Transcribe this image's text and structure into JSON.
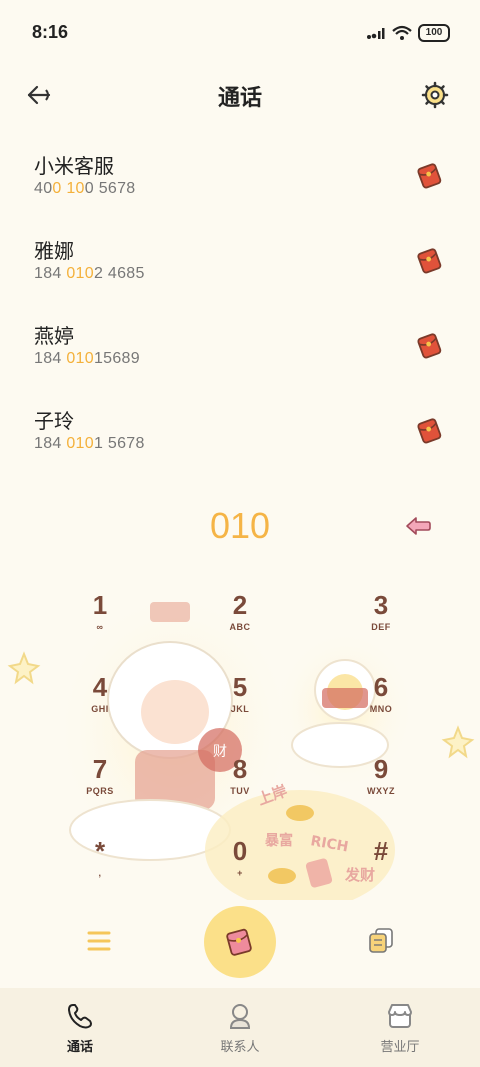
{
  "status": {
    "time": "8:16",
    "battery": "100"
  },
  "header": {
    "title": "通话"
  },
  "contacts": [
    {
      "name": "小米客服",
      "number_parts": [
        "40",
        "0",
        " ",
        "10",
        "0 5678"
      ]
    },
    {
      "name": "雅娜",
      "number_parts": [
        "184 ",
        "010",
        "2 4685"
      ]
    },
    {
      "name": "燕婷",
      "number_parts": [
        "184 ",
        "010",
        "15689"
      ]
    },
    {
      "name": "子玲",
      "number_parts": [
        "184 ",
        "010",
        "1 5678"
      ]
    }
  ],
  "dialer": {
    "input": "010"
  },
  "keypad": [
    {
      "digit": "1",
      "letters": "∞"
    },
    {
      "digit": "2",
      "letters": "ABC"
    },
    {
      "digit": "3",
      "letters": "DEF"
    },
    {
      "digit": "4",
      "letters": "GHI"
    },
    {
      "digit": "5",
      "letters": "JKL"
    },
    {
      "digit": "6",
      "letters": "MNO"
    },
    {
      "digit": "7",
      "letters": "PQRS"
    },
    {
      "digit": "8",
      "letters": "TUV"
    },
    {
      "digit": "9",
      "letters": "WXYZ"
    },
    {
      "digit": "*",
      "letters": ","
    },
    {
      "digit": "0",
      "letters": "+"
    },
    {
      "digit": "#",
      "letters": ""
    }
  ],
  "illustration_text": {
    "a": "上岸",
    "b": "暴富",
    "c": "RICH",
    "d": "发财",
    "e": "财"
  },
  "bottom_nav": [
    {
      "label": "通话"
    },
    {
      "label": "联系人"
    },
    {
      "label": "营业厅"
    }
  ],
  "colors": {
    "accent": "#f5b446",
    "brown": "#7a4a3a",
    "bg": "#fdfaf1"
  }
}
